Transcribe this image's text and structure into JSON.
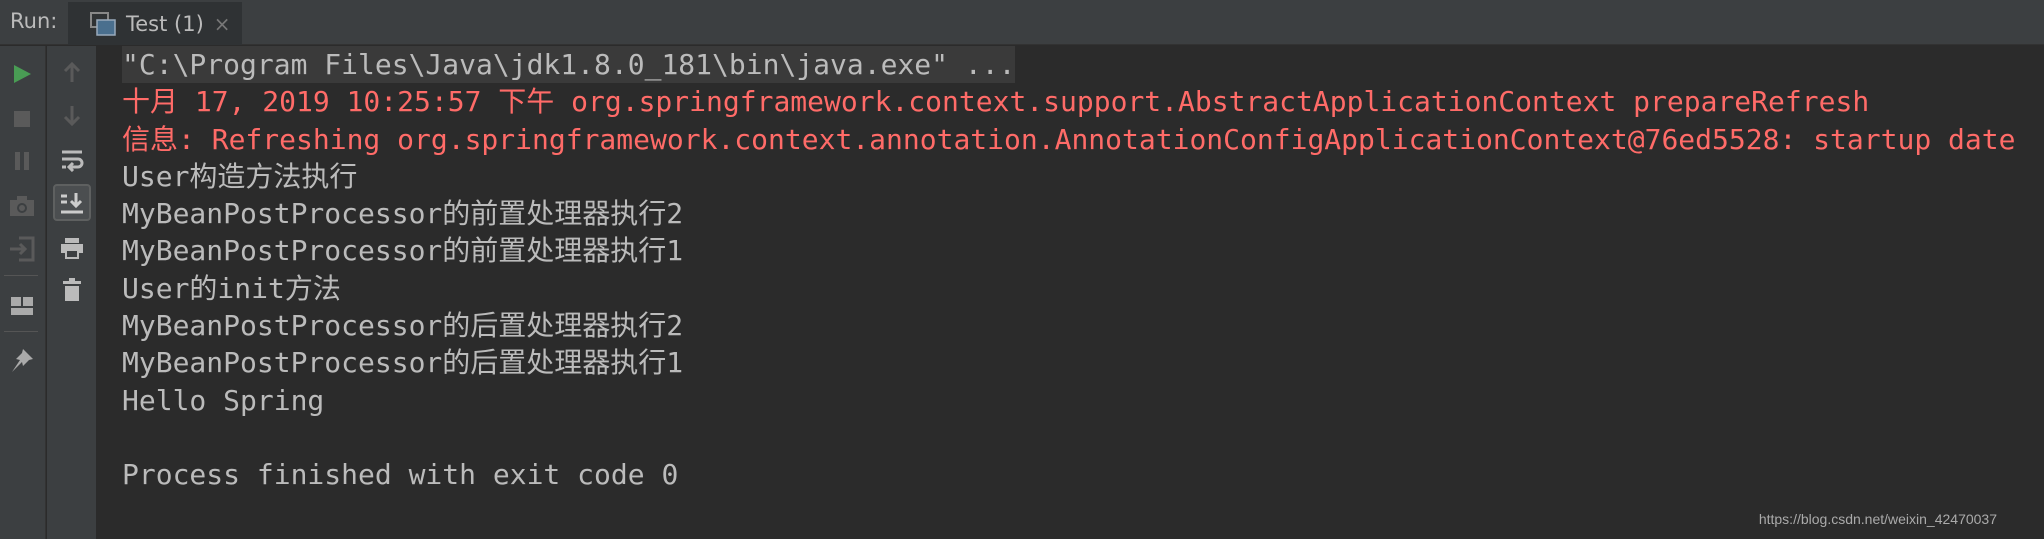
{
  "header": {
    "run_label": "Run:",
    "tab": {
      "label": "Test (1)",
      "close": "×",
      "icon": "console-window-icon"
    }
  },
  "toolbar_left": [
    "run-icon",
    "stop-icon",
    "pause-icon",
    "camera-icon",
    "login-icon",
    "layout-icon",
    "pin-icon"
  ],
  "toolbar_right": [
    "arrow-up-icon",
    "arrow-down-icon",
    "soft-wrap-icon",
    "scroll-to-end-icon",
    "print-icon",
    "trash-icon"
  ],
  "colors": {
    "background": "#2b2b2b",
    "error_text": "#ff6b68",
    "normal_text": "#bbbbbb",
    "run_green": "#499c54"
  },
  "console": {
    "lines": [
      {
        "text": "\"C:\\Program Files\\Java\\jdk1.8.0_181\\bin\\java.exe\" ...",
        "type": "cmd"
      },
      {
        "text": "十月 17, 2019 10:25:57 下午 org.springframework.context.support.AbstractApplicationContext prepareRefresh",
        "type": "red"
      },
      {
        "text": "信息: Refreshing org.springframework.context.annotation.AnnotationConfigApplicationContext@76ed5528: startup date",
        "type": "red"
      },
      {
        "text": "User构造方法执行",
        "type": "normal"
      },
      {
        "text": "MyBeanPostProcessor的前置处理器执行2",
        "type": "normal"
      },
      {
        "text": "MyBeanPostProcessor的前置处理器执行1",
        "type": "normal"
      },
      {
        "text": "User的init方法",
        "type": "normal"
      },
      {
        "text": "MyBeanPostProcessor的后置处理器执行2",
        "type": "normal"
      },
      {
        "text": "MyBeanPostProcessor的后置处理器执行1",
        "type": "normal"
      },
      {
        "text": "Hello Spring",
        "type": "normal"
      },
      {
        "text": "",
        "type": "normal"
      },
      {
        "text": "Process finished with exit code 0",
        "type": "normal"
      }
    ]
  },
  "watermark": "https://blog.csdn.net/weixin_42470037"
}
